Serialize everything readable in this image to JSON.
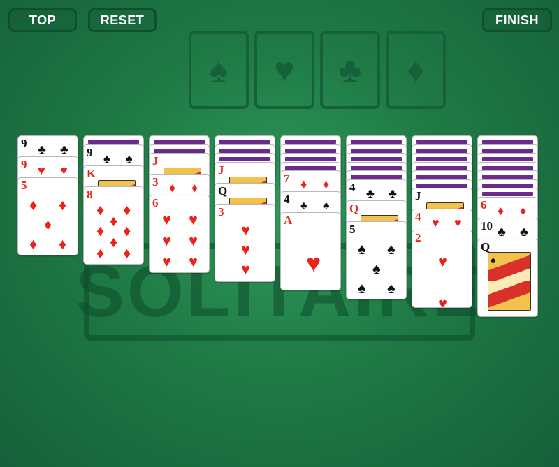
{
  "toolbar": {
    "top_label": "TOP",
    "reset_label": "RESET",
    "finish_label": "FINISH"
  },
  "foundations": [
    "♠",
    "♥",
    "♣",
    "♦"
  ],
  "watermark": "SOLITAIRE",
  "colors": {
    "felt": "#1f7a45",
    "card_back_stripe": "#6b2a8c",
    "red_suit": "#e8241b"
  },
  "piles": [
    {
      "backs": 0,
      "cards": [
        {
          "rank": "9",
          "suit": "♣",
          "color": "black"
        },
        {
          "rank": "9",
          "suit": "♥",
          "color": "red"
        },
        {
          "rank": "5",
          "suit": "♦",
          "color": "red"
        }
      ]
    },
    {
      "backs": 1,
      "cards": [
        {
          "rank": "9",
          "suit": "♠",
          "color": "black"
        },
        {
          "rank": "K",
          "suit": "♦",
          "color": "red"
        },
        {
          "rank": "8",
          "suit": "♦",
          "color": "red"
        }
      ]
    },
    {
      "backs": 2,
      "cards": [
        {
          "rank": "J",
          "suit": "♥",
          "color": "red"
        },
        {
          "rank": "3",
          "suit": "♦",
          "color": "red"
        },
        {
          "rank": "6",
          "suit": "♥",
          "color": "red"
        }
      ]
    },
    {
      "backs": 3,
      "cards": [
        {
          "rank": "J",
          "suit": "♦",
          "color": "red"
        },
        {
          "rank": "Q",
          "suit": "♠",
          "color": "black"
        },
        {
          "rank": "3",
          "suit": "♥",
          "color": "red"
        }
      ]
    },
    {
      "backs": 4,
      "cards": [
        {
          "rank": "7",
          "suit": "♦",
          "color": "red"
        },
        {
          "rank": "4",
          "suit": "♠",
          "color": "black"
        },
        {
          "rank": "A",
          "suit": "♥",
          "color": "red"
        }
      ]
    },
    {
      "backs": 5,
      "cards": [
        {
          "rank": "4",
          "suit": "♣",
          "color": "black"
        },
        {
          "rank": "Q",
          "suit": "♥",
          "color": "red"
        },
        {
          "rank": "5",
          "suit": "♠",
          "color": "black"
        }
      ]
    },
    {
      "backs": 6,
      "cards": [
        {
          "rank": "J",
          "suit": "♣",
          "color": "black"
        },
        {
          "rank": "4",
          "suit": "♥",
          "color": "red"
        },
        {
          "rank": "2",
          "suit": "♥",
          "color": "red"
        }
      ]
    },
    {
      "backs": 7,
      "cards": [
        {
          "rank": "6",
          "suit": "♦",
          "color": "red"
        },
        {
          "rank": "10",
          "suit": "♣",
          "color": "black"
        },
        {
          "rank": "Q",
          "suit": "♠",
          "color": "black"
        }
      ]
    }
  ]
}
